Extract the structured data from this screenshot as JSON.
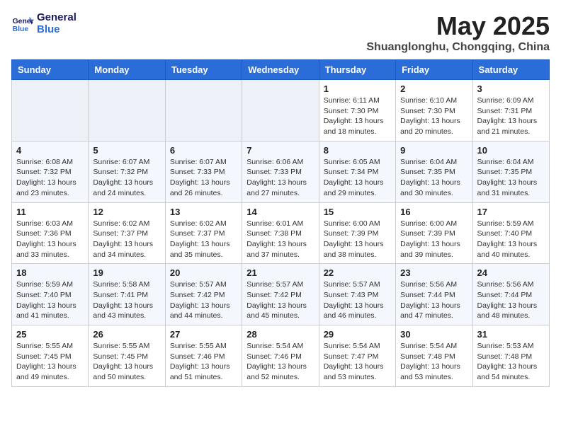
{
  "header": {
    "logo_line1": "General",
    "logo_line2": "Blue",
    "month": "May 2025",
    "location": "Shuanglonghu, Chongqing, China"
  },
  "weekdays": [
    "Sunday",
    "Monday",
    "Tuesday",
    "Wednesday",
    "Thursday",
    "Friday",
    "Saturday"
  ],
  "weeks": [
    [
      {
        "day": "",
        "info": ""
      },
      {
        "day": "",
        "info": ""
      },
      {
        "day": "",
        "info": ""
      },
      {
        "day": "",
        "info": ""
      },
      {
        "day": "1",
        "info": "Sunrise: 6:11 AM\nSunset: 7:30 PM\nDaylight: 13 hours\nand 18 minutes."
      },
      {
        "day": "2",
        "info": "Sunrise: 6:10 AM\nSunset: 7:30 PM\nDaylight: 13 hours\nand 20 minutes."
      },
      {
        "day": "3",
        "info": "Sunrise: 6:09 AM\nSunset: 7:31 PM\nDaylight: 13 hours\nand 21 minutes."
      }
    ],
    [
      {
        "day": "4",
        "info": "Sunrise: 6:08 AM\nSunset: 7:32 PM\nDaylight: 13 hours\nand 23 minutes."
      },
      {
        "day": "5",
        "info": "Sunrise: 6:07 AM\nSunset: 7:32 PM\nDaylight: 13 hours\nand 24 minutes."
      },
      {
        "day": "6",
        "info": "Sunrise: 6:07 AM\nSunset: 7:33 PM\nDaylight: 13 hours\nand 26 minutes."
      },
      {
        "day": "7",
        "info": "Sunrise: 6:06 AM\nSunset: 7:33 PM\nDaylight: 13 hours\nand 27 minutes."
      },
      {
        "day": "8",
        "info": "Sunrise: 6:05 AM\nSunset: 7:34 PM\nDaylight: 13 hours\nand 29 minutes."
      },
      {
        "day": "9",
        "info": "Sunrise: 6:04 AM\nSunset: 7:35 PM\nDaylight: 13 hours\nand 30 minutes."
      },
      {
        "day": "10",
        "info": "Sunrise: 6:04 AM\nSunset: 7:35 PM\nDaylight: 13 hours\nand 31 minutes."
      }
    ],
    [
      {
        "day": "11",
        "info": "Sunrise: 6:03 AM\nSunset: 7:36 PM\nDaylight: 13 hours\nand 33 minutes."
      },
      {
        "day": "12",
        "info": "Sunrise: 6:02 AM\nSunset: 7:37 PM\nDaylight: 13 hours\nand 34 minutes."
      },
      {
        "day": "13",
        "info": "Sunrise: 6:02 AM\nSunset: 7:37 PM\nDaylight: 13 hours\nand 35 minutes."
      },
      {
        "day": "14",
        "info": "Sunrise: 6:01 AM\nSunset: 7:38 PM\nDaylight: 13 hours\nand 37 minutes."
      },
      {
        "day": "15",
        "info": "Sunrise: 6:00 AM\nSunset: 7:39 PM\nDaylight: 13 hours\nand 38 minutes."
      },
      {
        "day": "16",
        "info": "Sunrise: 6:00 AM\nSunset: 7:39 PM\nDaylight: 13 hours\nand 39 minutes."
      },
      {
        "day": "17",
        "info": "Sunrise: 5:59 AM\nSunset: 7:40 PM\nDaylight: 13 hours\nand 40 minutes."
      }
    ],
    [
      {
        "day": "18",
        "info": "Sunrise: 5:59 AM\nSunset: 7:40 PM\nDaylight: 13 hours\nand 41 minutes."
      },
      {
        "day": "19",
        "info": "Sunrise: 5:58 AM\nSunset: 7:41 PM\nDaylight: 13 hours\nand 43 minutes."
      },
      {
        "day": "20",
        "info": "Sunrise: 5:57 AM\nSunset: 7:42 PM\nDaylight: 13 hours\nand 44 minutes."
      },
      {
        "day": "21",
        "info": "Sunrise: 5:57 AM\nSunset: 7:42 PM\nDaylight: 13 hours\nand 45 minutes."
      },
      {
        "day": "22",
        "info": "Sunrise: 5:57 AM\nSunset: 7:43 PM\nDaylight: 13 hours\nand 46 minutes."
      },
      {
        "day": "23",
        "info": "Sunrise: 5:56 AM\nSunset: 7:44 PM\nDaylight: 13 hours\nand 47 minutes."
      },
      {
        "day": "24",
        "info": "Sunrise: 5:56 AM\nSunset: 7:44 PM\nDaylight: 13 hours\nand 48 minutes."
      }
    ],
    [
      {
        "day": "25",
        "info": "Sunrise: 5:55 AM\nSunset: 7:45 PM\nDaylight: 13 hours\nand 49 minutes."
      },
      {
        "day": "26",
        "info": "Sunrise: 5:55 AM\nSunset: 7:45 PM\nDaylight: 13 hours\nand 50 minutes."
      },
      {
        "day": "27",
        "info": "Sunrise: 5:55 AM\nSunset: 7:46 PM\nDaylight: 13 hours\nand 51 minutes."
      },
      {
        "day": "28",
        "info": "Sunrise: 5:54 AM\nSunset: 7:46 PM\nDaylight: 13 hours\nand 52 minutes."
      },
      {
        "day": "29",
        "info": "Sunrise: 5:54 AM\nSunset: 7:47 PM\nDaylight: 13 hours\nand 53 minutes."
      },
      {
        "day": "30",
        "info": "Sunrise: 5:54 AM\nSunset: 7:48 PM\nDaylight: 13 hours\nand 53 minutes."
      },
      {
        "day": "31",
        "info": "Sunrise: 5:53 AM\nSunset: 7:48 PM\nDaylight: 13 hours\nand 54 minutes."
      }
    ]
  ]
}
